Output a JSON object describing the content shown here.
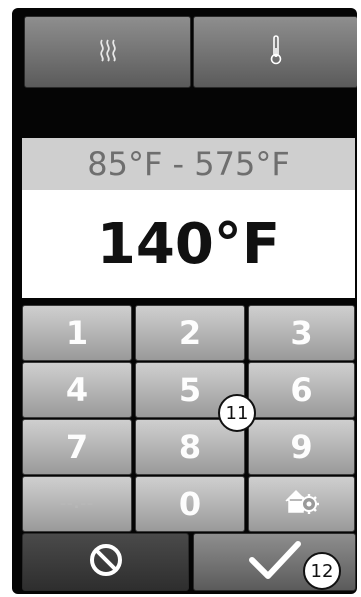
{
  "top_buttons": [
    {
      "icon": "heat-waves-icon"
    },
    {
      "icon": "thermometer-icon"
    }
  ],
  "range_text": "85°F - 575°F",
  "value_text": "140°F",
  "keypad": {
    "rows": [
      [
        "1",
        "2",
        "3"
      ],
      [
        "4",
        "5",
        "6"
      ],
      [
        "7",
        "8",
        "9"
      ],
      [
        "--:--",
        "0",
        ""
      ]
    ],
    "settings_icon": "house-gear-icon"
  },
  "bottom_buttons": {
    "cancel_icon": "cancel-icon",
    "confirm_icon": "checkmark-icon"
  },
  "callouts": {
    "keypad_label": "11",
    "confirm_label": "12"
  },
  "colors": {
    "screen_bg": "#050505",
    "key_top": "#cfcfcf",
    "key_bottom": "#9a9a9a",
    "range_bg": "#cfcfcf",
    "value_bg": "#ffffff"
  }
}
